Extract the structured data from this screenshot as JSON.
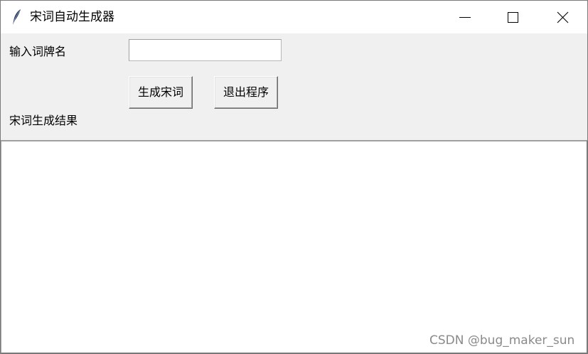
{
  "window": {
    "title": "宋词自动生成器",
    "icon": "feather-icon"
  },
  "controls": {
    "minimize_icon": "minimize-icon",
    "maximize_icon": "maximize-icon",
    "close_icon": "close-icon"
  },
  "form": {
    "cipai_label": "输入词牌名",
    "cipai_value": "",
    "generate_button": "生成宋词",
    "quit_button": "退出程序",
    "result_label": "宋词生成结果",
    "result_value": ""
  },
  "watermark": "CSDN @bug_maker_sun"
}
